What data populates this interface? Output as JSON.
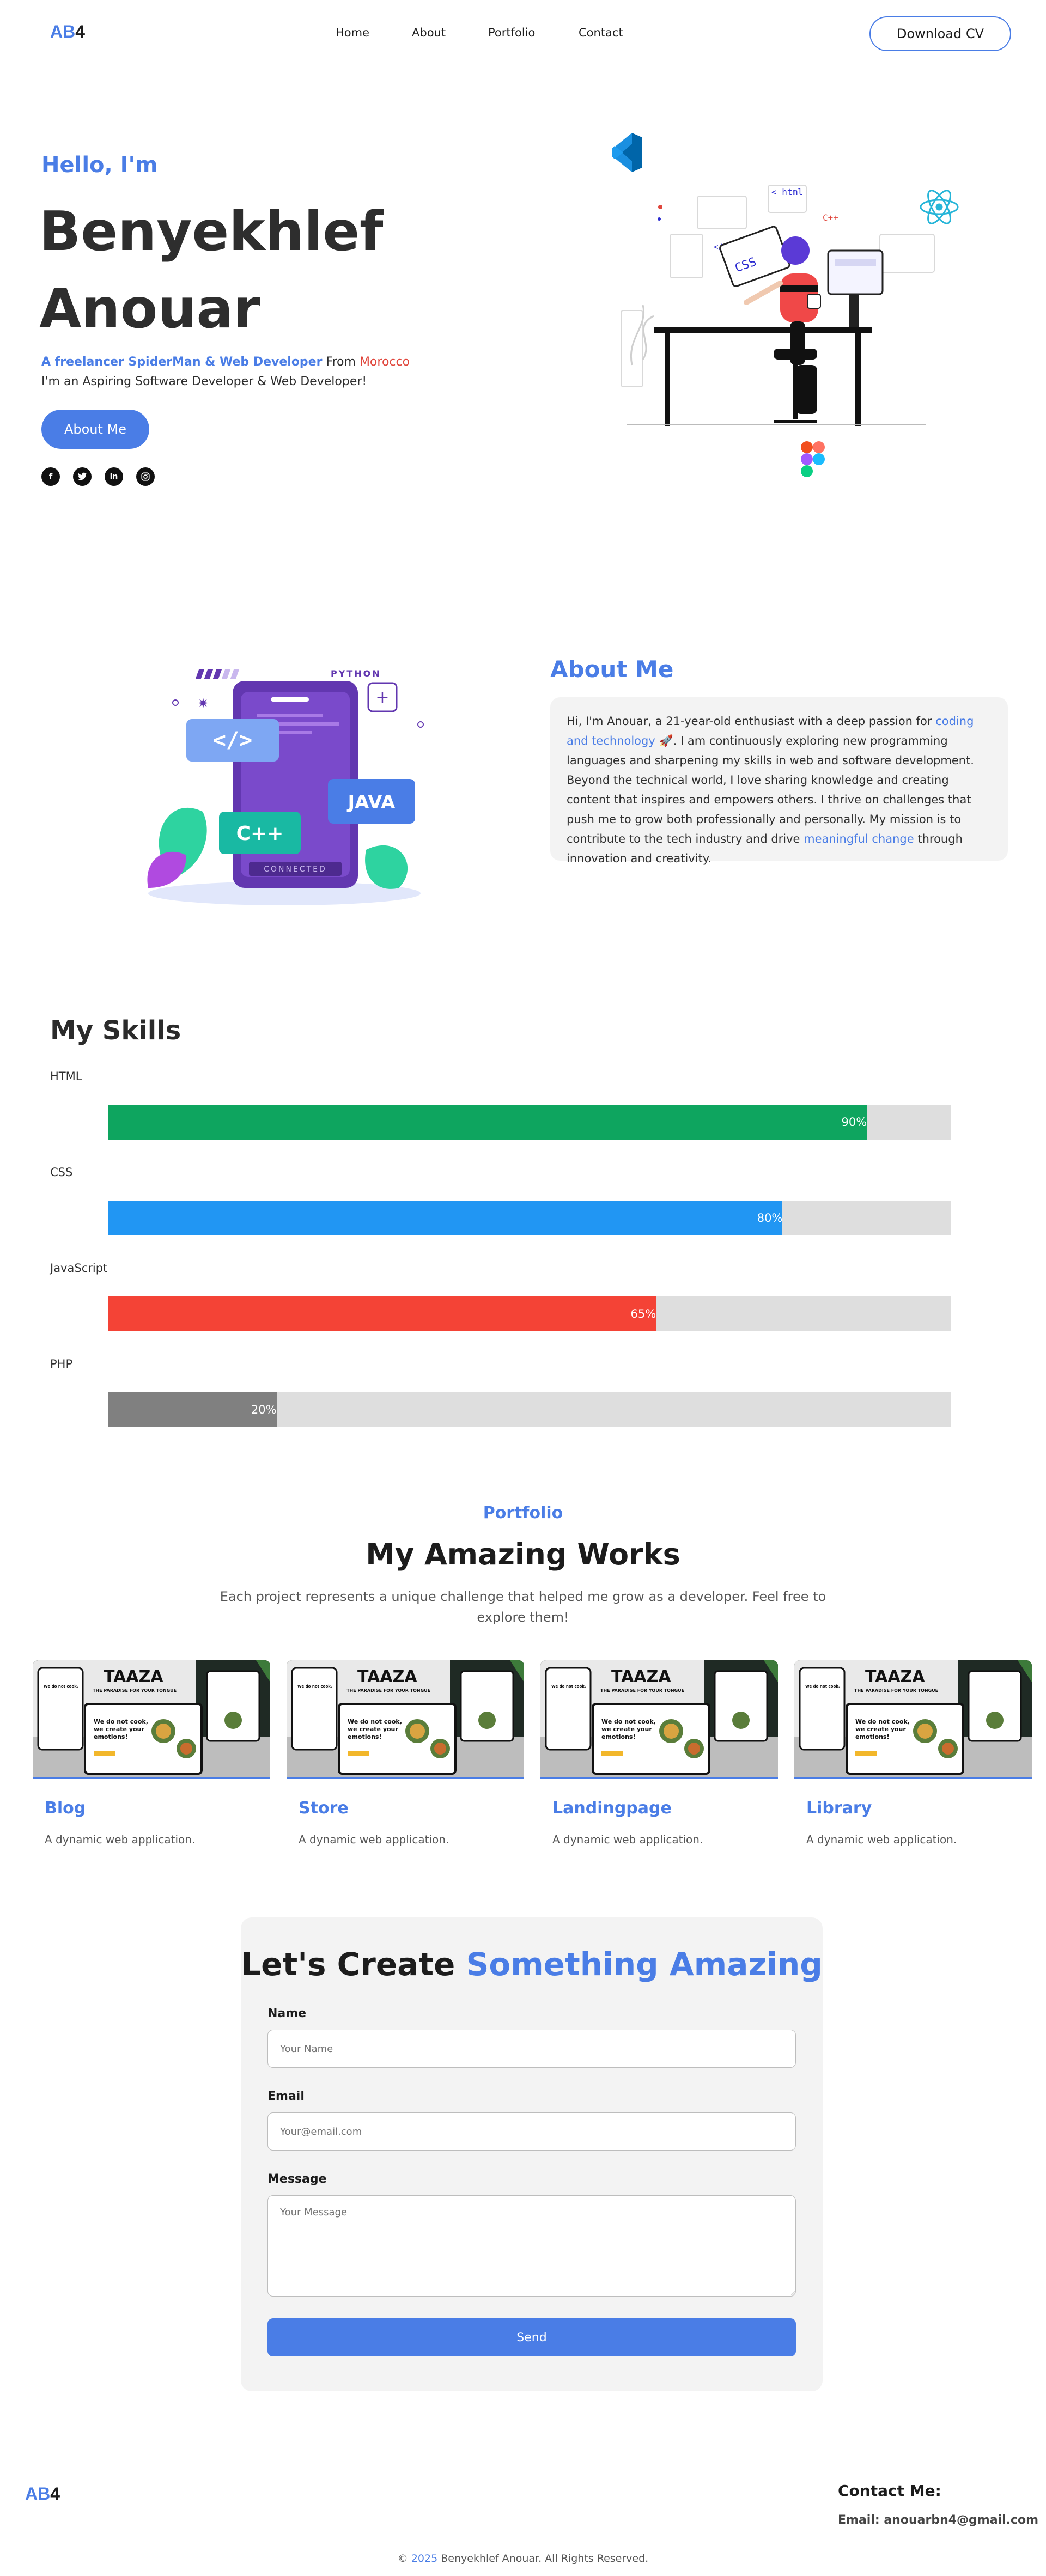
{
  "nav": {
    "logo_part1": "AB",
    "logo_part2": "4",
    "links": [
      "Home",
      "About",
      "Portfolio",
      "Contact"
    ],
    "cta": "Download CV"
  },
  "hero": {
    "greeting": "Hello, I'm",
    "name_line1": "Benyekhlef",
    "name_line2": "Anouar",
    "tag_blue": "A freelancer SpiderMan & Web Developer",
    "tag_from": " From ",
    "tag_country": "Morocco",
    "subtitle": "I'm an Aspiring Software Developer & Web Developer!",
    "button": "About Me",
    "socials": [
      "facebook-icon",
      "twitter-icon",
      "linkedin-icon",
      "instagram-icon"
    ],
    "illustration_texts": [
      "< html",
      "CSS",
      "</>"
    ]
  },
  "about": {
    "title": "About Me",
    "p1": "Hi, I'm Anouar, a 21-year-old enthusiast with a deep passion for ",
    "p1_link": "coding and technology",
    "p2": " 🚀. I am continuously exploring new programming languages and sharpening my skills in web and software development. Beyond the technical world, I love sharing knowledge and creating content that inspires and empowers others. I thrive on challenges that push me to grow both professionally and personally. My mission is to contribute to the tech industry and drive ",
    "p2_link": "meaningful change",
    "p3": " through innovation and creativity.",
    "illustration": {
      "lang1": "PYTHON",
      "lang2": "JAVA",
      "lang3": "C++",
      "code": "</>",
      "phone_label": "CONNECTED"
    }
  },
  "skills": {
    "title": "My Skills",
    "items": [
      {
        "label": "HTML",
        "percent": 90,
        "text": "90%",
        "color": "#0ea55f"
      },
      {
        "label": "CSS",
        "percent": 80,
        "text": "80%",
        "color": "#2196f3"
      },
      {
        "label": "JavaScript",
        "percent": 65,
        "text": "65%",
        "color": "#f44336"
      },
      {
        "label": "PHP",
        "percent": 20,
        "text": "20%",
        "color": "#808080"
      }
    ]
  },
  "portfolio": {
    "kicker": "Portfolio",
    "title": "My Amazing Works",
    "description": "Each project represents a unique challenge that helped me grow as a developer. Feel free to explore them!",
    "card_brand": "TAAZA",
    "card_tagline": "THE PARADISE FOR YOUR TONGUE",
    "card_copy": "We do not cook, we create your emotions!",
    "cards": [
      {
        "title": "Blog",
        "desc": "A dynamic web application."
      },
      {
        "title": "Store",
        "desc": "A dynamic web application."
      },
      {
        "title": "Landingpage",
        "desc": "A dynamic web application."
      },
      {
        "title": "Library",
        "desc": "A dynamic web application."
      }
    ]
  },
  "contact": {
    "title_dark": "Let's Create ",
    "title_blue": "Something Amazing",
    "name_label": "Name",
    "name_placeholder": "Your Name",
    "email_label": "Email",
    "email_placeholder": "Your@email.com",
    "message_label": "Message",
    "message_placeholder": "Your Message",
    "send": "Send"
  },
  "footer": {
    "logo_part1": "AB",
    "logo_part2": "4",
    "contact_title": "Contact Me:",
    "email": "Email: anouarbn4@gmail.com",
    "copyright_prefix": "© ",
    "copyright_year": "2025",
    "copyright_text": " Benyekhlef Anouar. All Rights Reserved."
  }
}
